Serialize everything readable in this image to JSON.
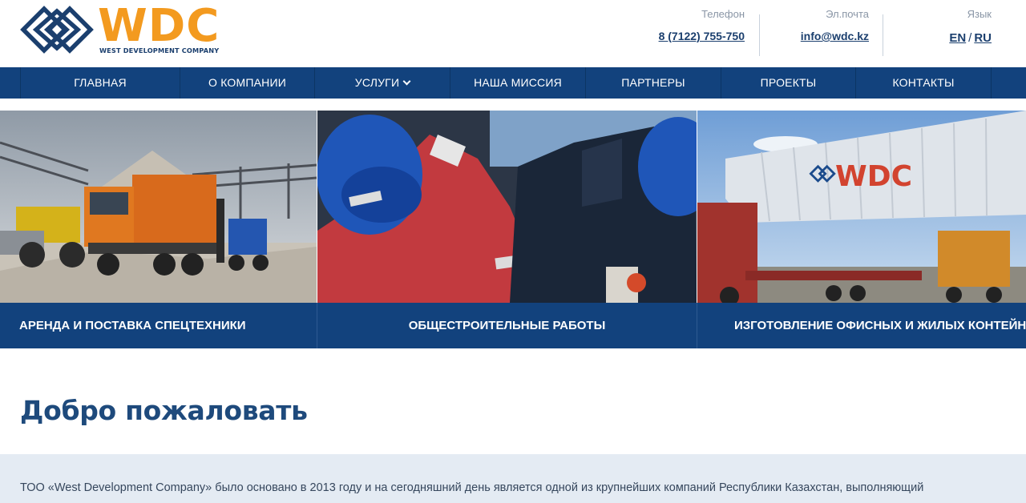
{
  "brand": {
    "name": "WDC",
    "tagline": "WEST DEVELOPMENT COMPANY",
    "accent_color": "#f39a1f",
    "primary_color": "#12427d"
  },
  "contacts": {
    "phone": {
      "label": "Телефон",
      "value": "8 (7122) 755-750"
    },
    "email": {
      "label": "Эл.почта",
      "value": "info@wdc.kz"
    },
    "language": {
      "label": "Язык",
      "options": [
        "EN",
        "RU"
      ],
      "separator": "/"
    }
  },
  "nav": {
    "items": [
      {
        "label": "ГЛАВНАЯ"
      },
      {
        "label": "О КОМПАНИИ"
      },
      {
        "label": "УСЛУГИ",
        "icon": "chevron-down-icon"
      },
      {
        "label": "НАША МИССИЯ"
      },
      {
        "label": "ПАРТНЕРЫ"
      },
      {
        "label": "ПРОЕКТЫ"
      },
      {
        "label": "КОНТАКТЫ"
      }
    ]
  },
  "banner": {
    "panels": [
      {
        "caption": "АРЕНДА И ПОСТАВКА СПЕЦТЕХНИКИ",
        "image": "construction-machinery-photo"
      },
      {
        "caption": "ОБЩЕСТРОИТЕЛЬНЫЕ РАБОТЫ",
        "image": "workers-in-hardhats-photo"
      },
      {
        "caption": "ИЗГОТОВЛЕНИЕ ОФИСНЫХ И ЖИЛЫХ КОНТЕЙНЕРОВ",
        "image": "container-on-trailer-photo",
        "image_text": "WDC"
      }
    ]
  },
  "welcome": {
    "title": "Добро пожаловать",
    "intro": "ТОО «West Development Company» было основано в 2013 году и на сегодняшний день является одной из крупнейших компаний Республики Казахстан, выполняющий"
  }
}
